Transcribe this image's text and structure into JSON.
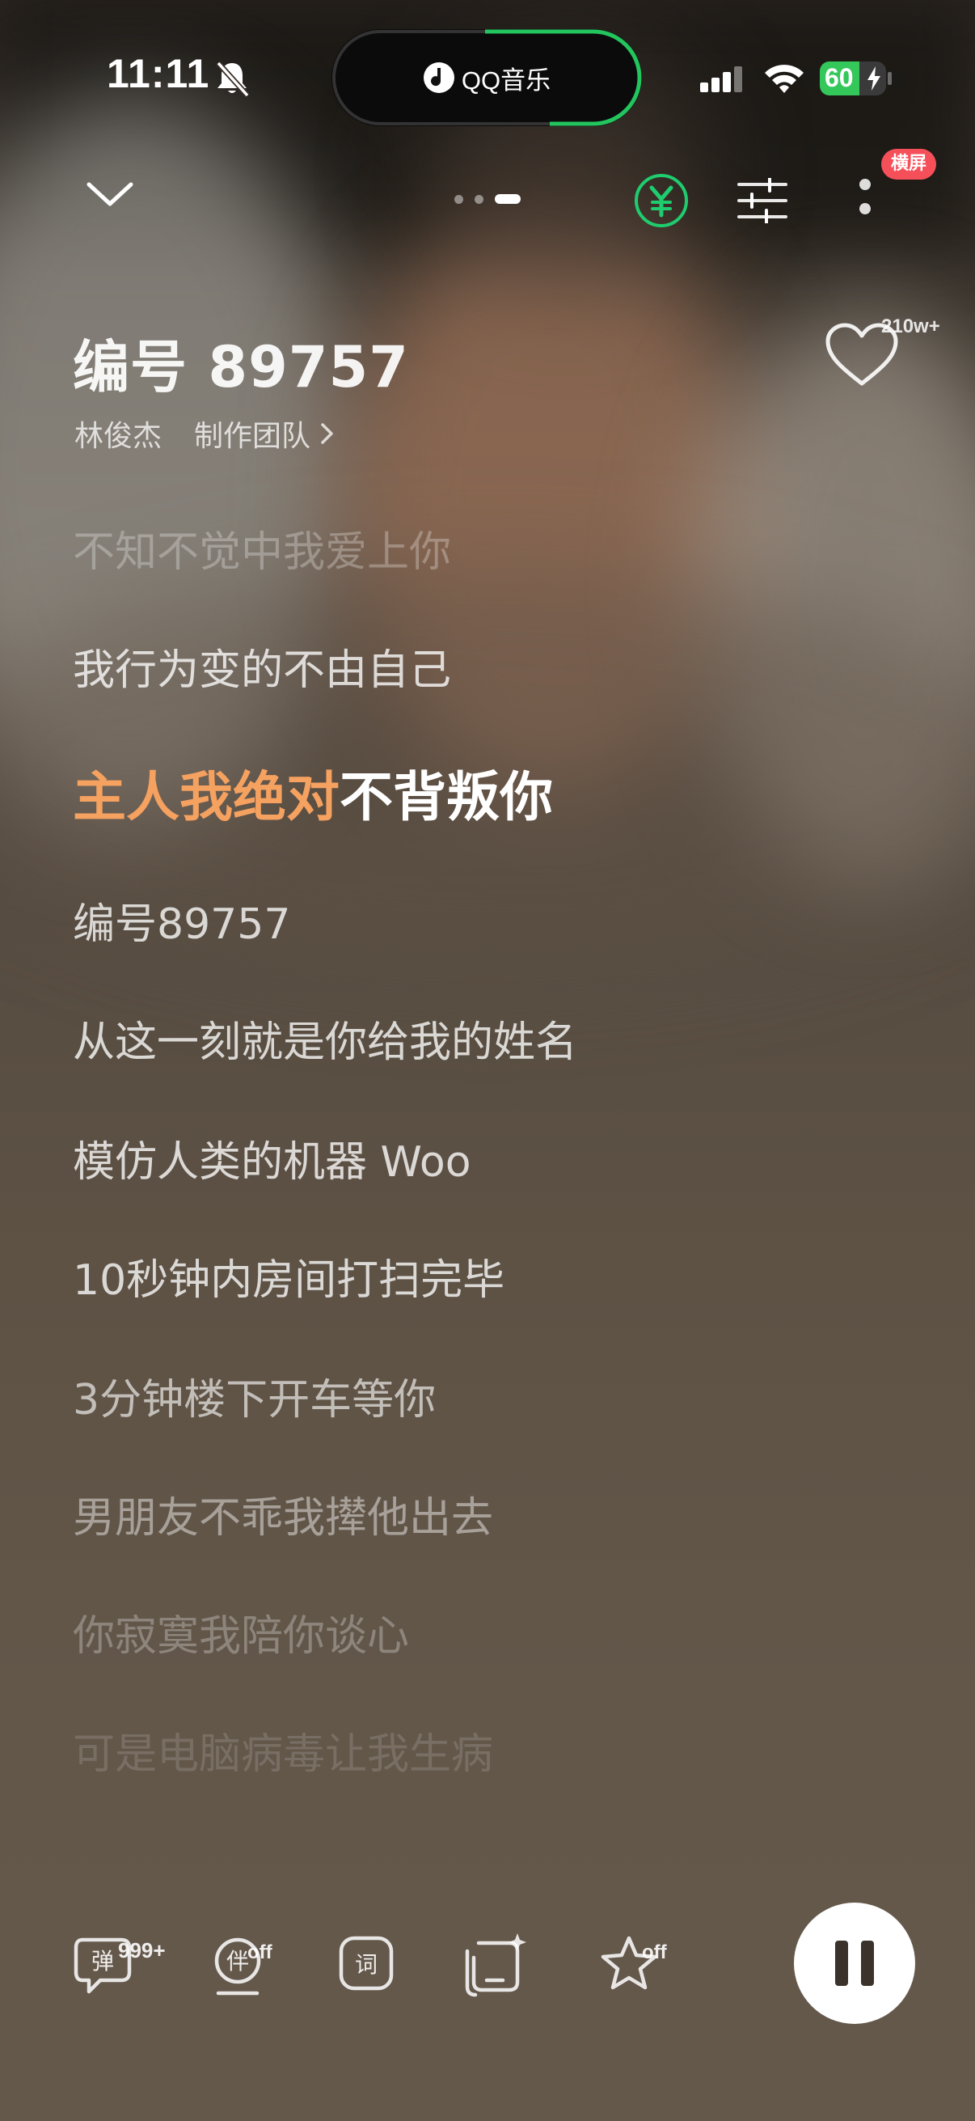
{
  "status_bar": {
    "time": "11:11",
    "island_app": "QQ音乐",
    "battery_percent": "60"
  },
  "toolbar": {
    "landscape_badge": "横屏",
    "pager_active_index": 2,
    "pager_count": 3
  },
  "song": {
    "title": "编号 89757",
    "artist": "林俊杰",
    "credits_link": "制作团队",
    "like_count": "210w+"
  },
  "lyrics": {
    "lines": [
      "不知不觉中我爱上你",
      "我行为变的不由自己",
      "主人我绝对不背叛你",
      "编号89757",
      "从这一刻就是你给我的姓名",
      "模仿人类的机器 Woo",
      "10秒钟内房间打扫完毕",
      "3分钟楼下开车等你",
      "男朋友不乖我撵他出去",
      "你寂寞我陪你谈心",
      "可是电脑病毒让我生病"
    ],
    "current_line_index": 2,
    "current_sung": "主人我绝对",
    "current_unsung": "不背叛你"
  },
  "controls": {
    "danmu_glyph": "弹",
    "danmu_count": "999+",
    "accompany_glyph": "伴",
    "accompany_state": "off",
    "lyrics_glyph": "词",
    "favorite_state": "off"
  },
  "colors": {
    "sung_lyric": "#f5a160",
    "landscape_badge": "#f5505a",
    "vip_green": "#1fcc6e",
    "battery_green": "#34c759"
  }
}
